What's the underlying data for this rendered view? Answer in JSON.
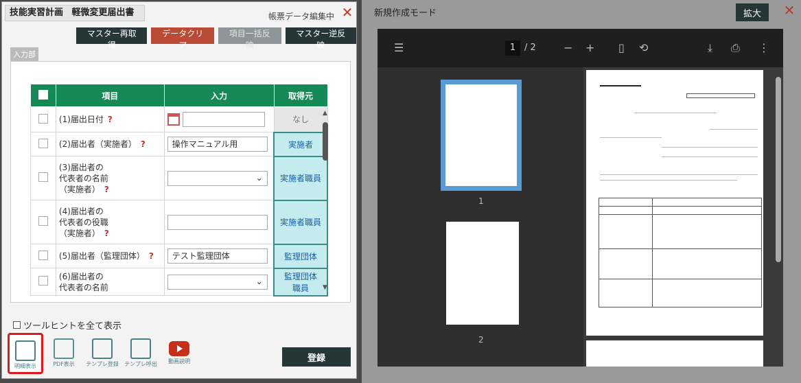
{
  "dialog": {
    "title_main": "技能実習計画",
    "title_sub": "軽微変更届出書",
    "status": "帳票データ編集中",
    "close": "✕"
  },
  "toolbar": {
    "master_reload": "マスター再取得",
    "data_clear": "データクリア",
    "bulk_apply": "項目一括反映",
    "master_reverse": "マスター逆反映"
  },
  "input_mode_tag": "入力部",
  "table": {
    "headers": {
      "item": "項目",
      "input": "入力",
      "source": "取得元"
    },
    "rows": [
      {
        "label": "(1)届出日付",
        "input_value": "",
        "source": "なし"
      },
      {
        "label": "(2)届出者（実施者）",
        "input_value": "操作マニュアル用",
        "source": "実施者"
      },
      {
        "label_l1": "(3)届出者の",
        "label_l2": "代表者の名前",
        "label_l3": "（実施者）",
        "source": "実施者職員"
      },
      {
        "label_l1": "(4)届出者の",
        "label_l2": "代表者の役職",
        "label_l3": "（実施者）",
        "source": "実施者職員"
      },
      {
        "label": "(5)届出者（監理団体）",
        "input_value": "テスト監理団体",
        "source": "監理団体"
      },
      {
        "label_l1": "(6)届出者の",
        "label_l2": "代表者の名前",
        "source_l1": "監理団体",
        "source_l2": "職員"
      }
    ],
    "help_mark": "?"
  },
  "tooltip_toggle": "ツールヒントを全て表示",
  "tools": [
    {
      "label": "明細表示"
    },
    {
      "label": "PDF表示"
    },
    {
      "label": "テンプレ登録"
    },
    {
      "label": "テンプレ呼出"
    },
    {
      "label": "動画説明"
    }
  ],
  "register": "登録",
  "preview": {
    "title": "新規作成モード",
    "zoom": "拡大",
    "close": "✕",
    "page_current": "1",
    "page_total": "/ 2",
    "thumb1_num": "1",
    "thumb2_num": "2"
  }
}
